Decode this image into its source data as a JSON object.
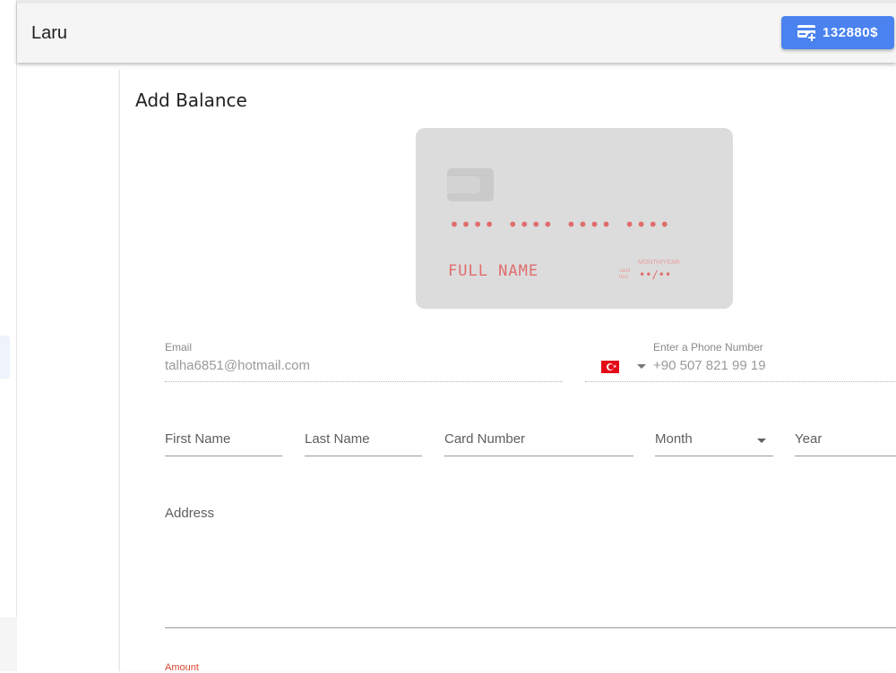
{
  "app": {
    "title": "Laru"
  },
  "header": {
    "balance": "132880$"
  },
  "page": {
    "heading": "Add Balance"
  },
  "card_preview": {
    "number": "•••• •••• •••• ••••",
    "holder": "FULL NAME",
    "valid_thru": "valid thru",
    "month_year": "MONTH/YEAR",
    "expiry": "••/••"
  },
  "form": {
    "email": {
      "label": "Email",
      "value": "talha6851@hotmail.com"
    },
    "phone": {
      "label": "Enter a Phone Number",
      "value": "+90 507 821 99 19"
    },
    "first_name": {
      "placeholder": "First Name"
    },
    "last_name": {
      "placeholder": "Last Name"
    },
    "card_number": {
      "placeholder": "Card Number"
    },
    "month": {
      "placeholder": "Month"
    },
    "year": {
      "placeholder": "Year"
    },
    "address": {
      "placeholder": "Address"
    },
    "amount": {
      "label": "Amount"
    }
  },
  "colors": {
    "accent": "#4a82f0",
    "card_text": "#e06d6d",
    "error": "#d9452f"
  }
}
